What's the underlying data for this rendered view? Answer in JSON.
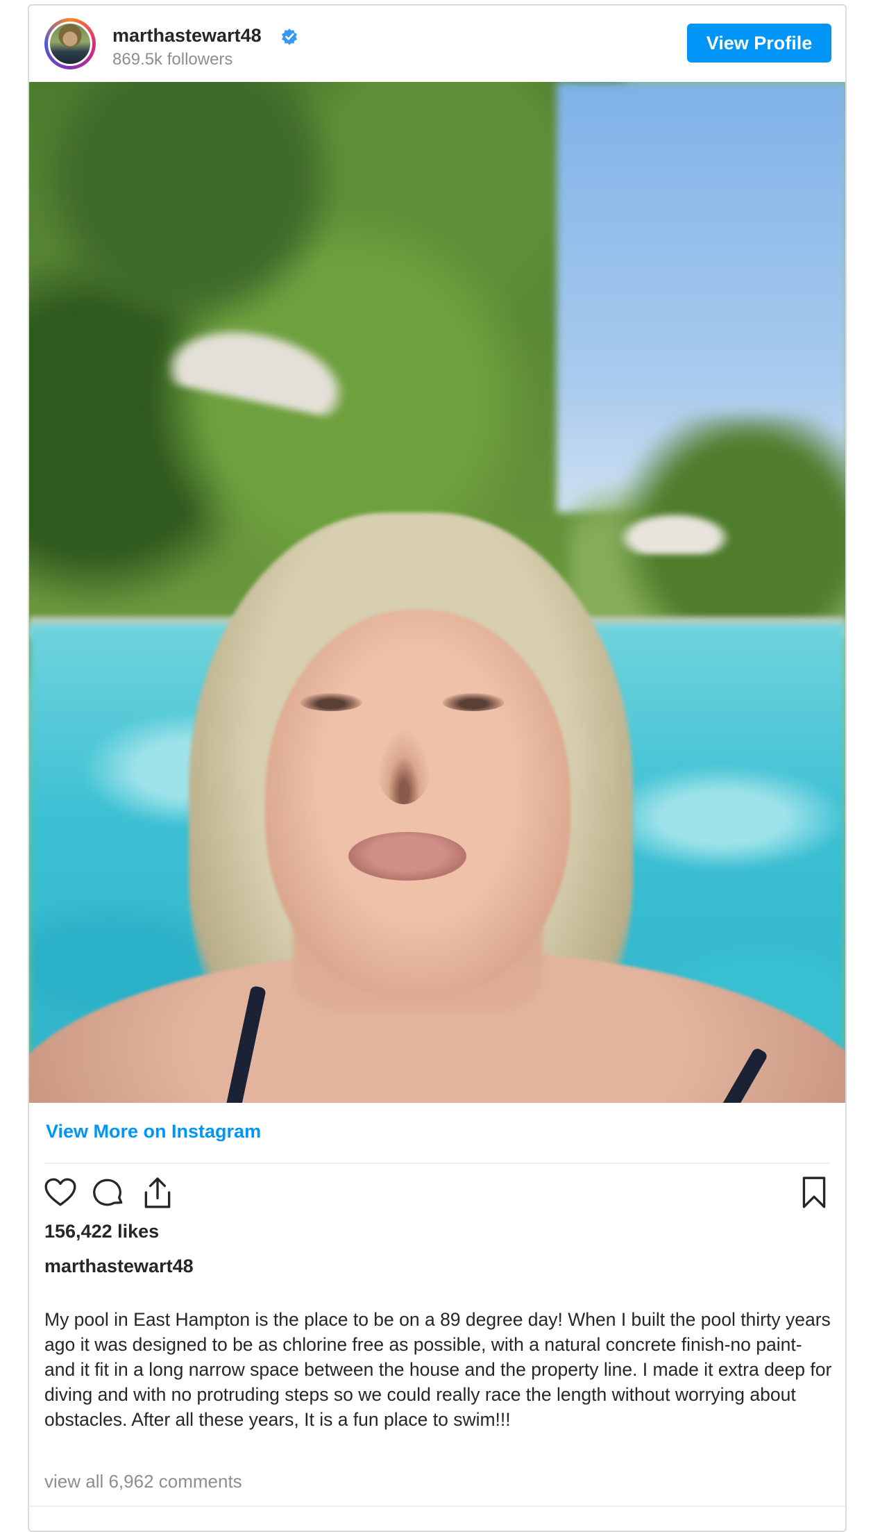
{
  "header": {
    "username": "marthastewart48",
    "followers": "869.5k followers",
    "view_profile_label": "View Profile"
  },
  "post": {
    "view_more_label": "View More on Instagram",
    "likes": "156,422 likes",
    "caption_user": "marthastewart48",
    "caption": "My pool in East Hampton is the place to be on a 89 degree day! When I built the pool thirty years ago it was designed to be as chlorine free as possible, with a natural concrete finish-no paint- and it fit in a long narrow space between the house and the property line. I made it extra deep for diving and with no protruding steps so we could really race the length without worrying about obstacles. After all these years, It is a fun place to swim!!!",
    "comments_label": "view all 6,962 comments"
  },
  "icons": {
    "verified": "verified-badge-icon",
    "like": "heart-icon",
    "comment": "comment-bubble-icon",
    "share": "share-icon",
    "save": "bookmark-icon"
  },
  "colors": {
    "accent": "#0095f6",
    "text": "#262626",
    "secondary_text": "#8e8e8e",
    "border": "#dbdbdb"
  }
}
